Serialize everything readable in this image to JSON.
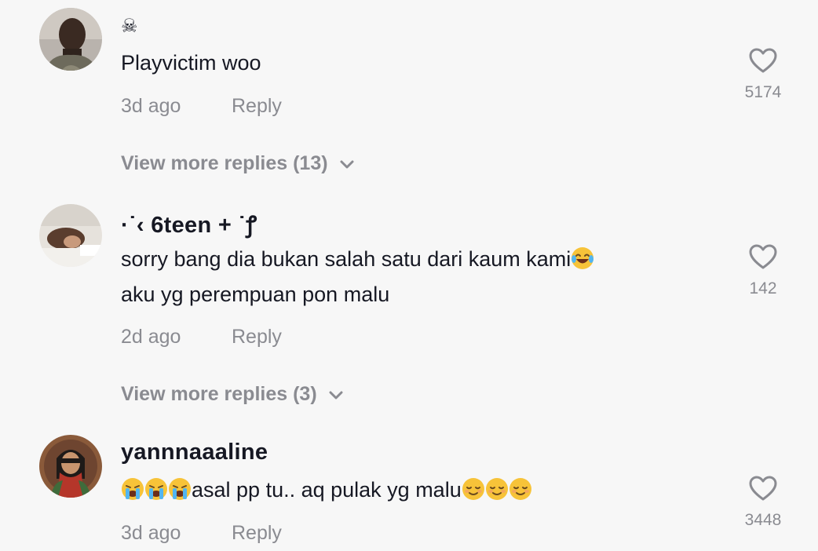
{
  "comments": [
    {
      "username": "☠",
      "text_lines": [
        "Playvictim woo"
      ],
      "time": "3d ago",
      "reply_label": "Reply",
      "likes": "5174",
      "view_more": "View more replies (13)"
    },
    {
      "username": "·˙‹ 6teen + ˙ꝭ",
      "text_lines": [
        "sorry bang dia bukan salah satu dari kaum kami",
        "aku yg perempuan pon malu"
      ],
      "time": "2d ago",
      "reply_label": "Reply",
      "likes": "142",
      "view_more": "View more replies (3)"
    },
    {
      "username": "yannnaaaline",
      "text_lines": [
        "asal pp tu.. aq pulak yg malu"
      ],
      "time": "3d ago",
      "reply_label": "Reply",
      "likes": "3448"
    }
  ],
  "icons": {
    "like": "heart-outline-icon",
    "expand": "chevron-down-icon",
    "emoji_laugh": "face-with-tears-of-joy",
    "emoji_cry": "loudly-crying-face",
    "emoji_relieved": "relieved-face"
  },
  "colors": {
    "background": "#f7f7f7",
    "primary_text": "#161823",
    "secondary_text": "#8a8b91",
    "emoji_yellow": "#f7c339"
  }
}
